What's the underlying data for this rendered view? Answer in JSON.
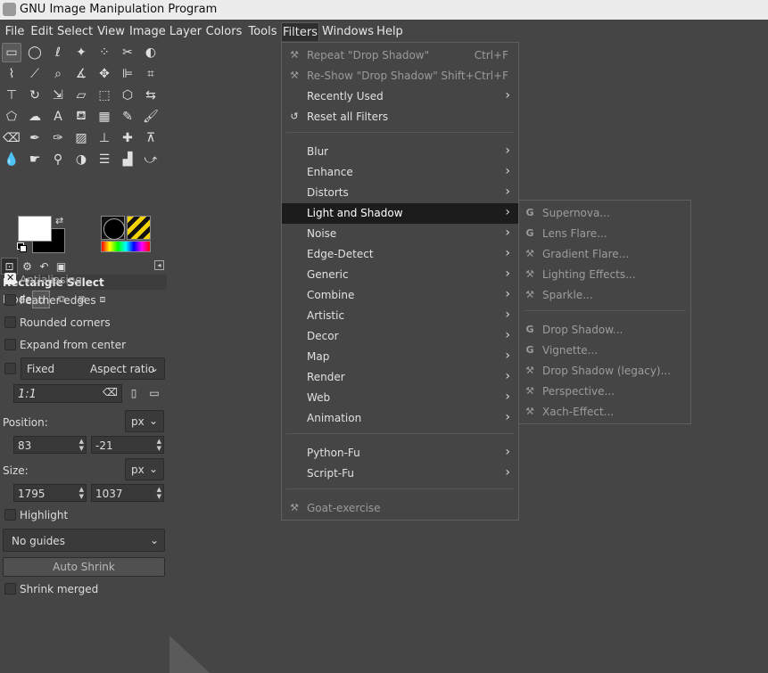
{
  "window": {
    "title": "GNU Image Manipulation Program"
  },
  "menubar": [
    "File",
    "Edit",
    "Select",
    "View",
    "Image",
    "Layer",
    "Colors",
    "Tools",
    "Filters",
    "Windows",
    "Help"
  ],
  "toolbox": {
    "tool_options_title": "Rectangle Select",
    "mode_label": "Mode:",
    "antialiasing": "Antialiasing",
    "feather_edges": "Feather edges",
    "rounded_corners": "Rounded corners",
    "expand_from_center": "Expand from center",
    "fixed_label": "Fixed",
    "fixed_mode": "Aspect ratio",
    "ratio_value": "1:1",
    "position_label": "Position:",
    "position_unit": "px",
    "position_x": "83",
    "position_y": "-21",
    "size_label": "Size:",
    "size_unit": "px",
    "size_w": "1795",
    "size_h": "1037",
    "highlight": "Highlight",
    "guides": "No guides",
    "auto_shrink": "Auto Shrink",
    "shrink_merged": "Shrink merged"
  },
  "filters_menu": {
    "repeat": {
      "label": "Repeat \"Drop Shadow\"",
      "accel": "Ctrl+F"
    },
    "reshow": {
      "label": "Re-Show \"Drop Shadow\"",
      "accel": "Shift+Ctrl+F"
    },
    "recently_used": "Recently Used",
    "reset_all": "Reset all Filters",
    "categories": [
      "Blur",
      "Enhance",
      "Distorts",
      "Light and Shadow",
      "Noise",
      "Edge-Detect",
      "Generic",
      "Combine",
      "Artistic",
      "Decor",
      "Map",
      "Render",
      "Web",
      "Animation"
    ],
    "scripting": [
      "Python-Fu",
      "Script-Fu"
    ],
    "goat": "Goat-exercise"
  },
  "light_shadow_submenu": {
    "group1": [
      "Supernova...",
      "Lens Flare...",
      "Gradient Flare...",
      "Lighting Effects...",
      "Sparkle..."
    ],
    "group2": [
      "Drop Shadow...",
      "Vignette...",
      "Drop Shadow (legacy)...",
      "Perspective...",
      "Xach-Effect..."
    ]
  },
  "colors": {
    "background": "#454545",
    "highlight": "#1c1c1c",
    "disabled_text": "#9a9a9a"
  }
}
